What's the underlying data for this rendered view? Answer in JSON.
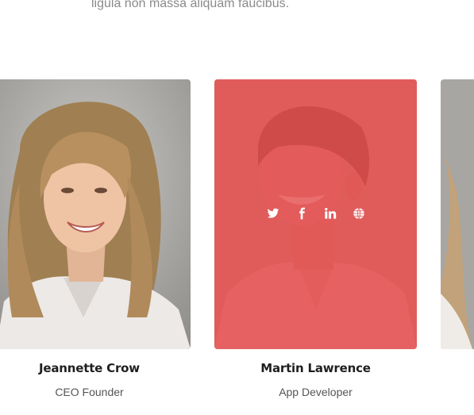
{
  "section": {
    "intro_text": "ligula non massa aliquam faucibus."
  },
  "team": [
    {
      "name": "Jeannette Crow",
      "role": "CEO Founder"
    },
    {
      "name": "Martin Lawrence",
      "role": "App Developer"
    },
    {
      "name": "",
      "role": ""
    }
  ],
  "social_icons": [
    "twitter-icon",
    "facebook-icon",
    "linkedin-icon",
    "globe-icon"
  ],
  "colors": {
    "overlay": "#e55050",
    "name_text": "#1f1f1f",
    "role_text": "#555555",
    "intro_text": "#8a8a8a"
  }
}
